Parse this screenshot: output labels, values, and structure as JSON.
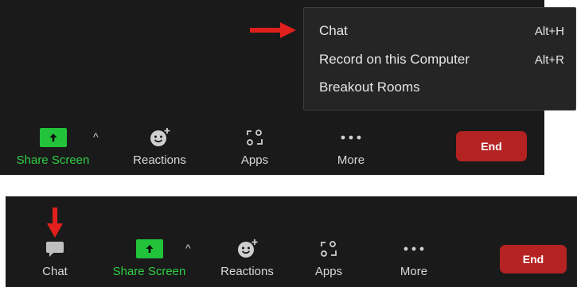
{
  "top_toolbar": {
    "share_screen_label": "Share Screen",
    "reactions_label": "Reactions",
    "apps_label": "Apps",
    "more_label": "More",
    "end_label": "End",
    "caret": "^"
  },
  "more_menu": {
    "items": [
      {
        "label": "Chat",
        "shortcut": "Alt+H"
      },
      {
        "label": "Record on this Computer",
        "shortcut": "Alt+R"
      },
      {
        "label": "Breakout Rooms",
        "shortcut": ""
      }
    ]
  },
  "bottom_toolbar": {
    "chat_label": "Chat",
    "share_screen_label": "Share Screen",
    "reactions_label": "Reactions",
    "apps_label": "Apps",
    "more_label": "More",
    "end_label": "End",
    "caret": "^"
  },
  "colors": {
    "toolbar_bg": "#1a1a1a",
    "share_green": "#22c33a",
    "share_label_green": "#2fcf43",
    "end_red": "#b42222",
    "annotation_arrow_red": "#e0201c",
    "menu_bg": "#252525"
  },
  "icons": [
    "share-screen-icon",
    "reactions-icon",
    "apps-icon",
    "more-icon",
    "chat-icon",
    "annotation-arrow-icon"
  ]
}
